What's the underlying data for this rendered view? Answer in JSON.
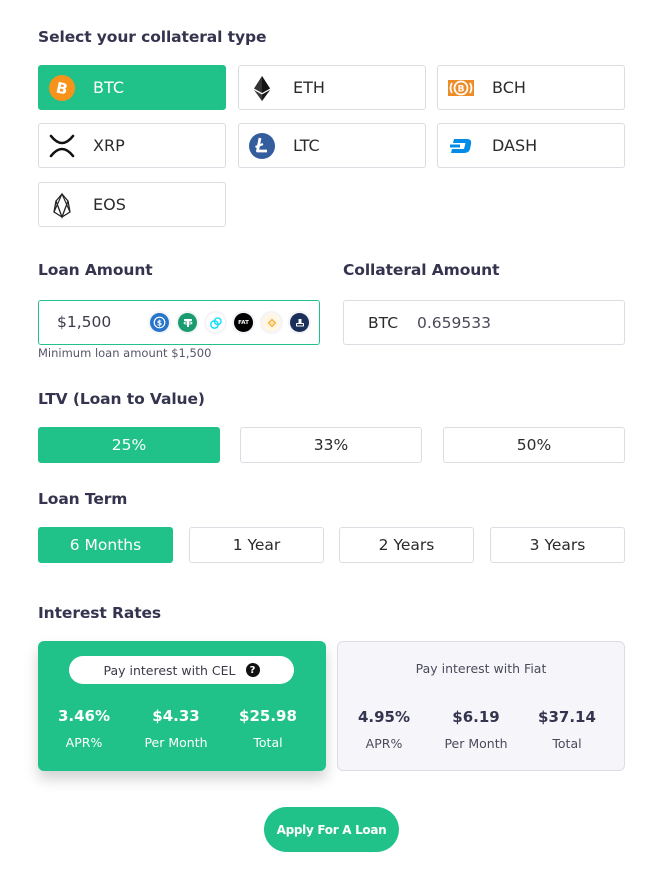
{
  "collateral": {
    "title": "Select your collateral type",
    "selected": "BTC",
    "options": [
      {
        "label": "BTC",
        "icon": "bitcoin-icon",
        "active": true
      },
      {
        "label": "ETH",
        "icon": "ethereum-icon",
        "active": false
      },
      {
        "label": "BCH",
        "icon": "bitcoin-cash-icon",
        "active": false
      },
      {
        "label": "XRP",
        "icon": "xrp-icon",
        "active": false
      },
      {
        "label": "LTC",
        "icon": "litecoin-icon",
        "active": false
      },
      {
        "label": "DASH",
        "icon": "dash-icon",
        "active": false
      },
      {
        "label": "EOS",
        "icon": "eos-icon",
        "active": false
      }
    ]
  },
  "loan_amount": {
    "title": "Loan Amount",
    "value": "$1,500",
    "hint": "Minimum loan amount $1,500",
    "stablecoin_icons": [
      "usdc-icon",
      "tether-icon",
      "gemini-dollar-icon",
      "fiat-icon",
      "pax-gold-icon",
      "trueusd-icon"
    ]
  },
  "collateral_amount": {
    "title": "Collateral Amount",
    "currency": "BTC",
    "value": "0.659533"
  },
  "ltv": {
    "title": "LTV (Loan to Value)",
    "options": [
      "25%",
      "33%",
      "50%"
    ],
    "selected": "25%"
  },
  "loan_term": {
    "title": "Loan Term",
    "options": [
      "6 Months",
      "1 Year",
      "2 Years",
      "3 Years"
    ],
    "selected": "6 Months"
  },
  "interest": {
    "title": "Interest Rates",
    "cel": {
      "label": "Pay interest with CEL",
      "help": "?",
      "apr": "3.46%",
      "apr_label": "APR%",
      "per_month": "$4.33",
      "per_month_label": "Per Month",
      "total": "$25.98",
      "total_label": "Total"
    },
    "fiat": {
      "label": "Pay interest with Fiat",
      "apr": "4.95%",
      "apr_label": "APR%",
      "per_month": "$6.19",
      "per_month_label": "Per Month",
      "total": "$37.14",
      "total_label": "Total"
    }
  },
  "apply_button": "Apply For A Loan",
  "colors": {
    "accent": "#21c28a",
    "title": "#35344f",
    "border": "#dcdde3",
    "fiat_card_bg": "#f6f6fa"
  }
}
